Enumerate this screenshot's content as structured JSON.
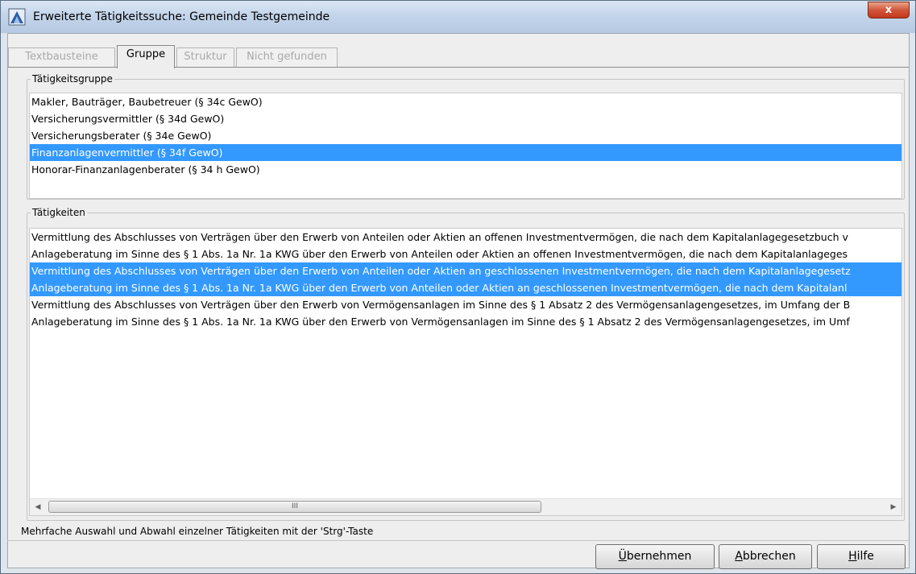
{
  "window": {
    "title": "Erweiterte Tätigkeitssuche: Gemeinde Testgemeinde",
    "close_glyph": "x"
  },
  "tabs": [
    {
      "label": "Textbausteine",
      "active": false
    },
    {
      "label": "Gruppe",
      "active": true
    },
    {
      "label": "Struktur",
      "active": false
    },
    {
      "label": "Nicht gefunden",
      "active": false
    }
  ],
  "group_section": {
    "legend": "Tätigkeitsgruppe",
    "items": [
      {
        "label": "Makler, Bauträger, Baubetreuer (§ 34c GewO)",
        "selected": false
      },
      {
        "label": "Versicherungsvermittler (§ 34d GewO)",
        "selected": false
      },
      {
        "label": "Versicherungsberater (§ 34e GewO)",
        "selected": false
      },
      {
        "label": "Finanzanlagenvermittler (§ 34f GewO)",
        "selected": true
      },
      {
        "label": "Honorar-Finanzanlagenberater (§ 34 h GewO)",
        "selected": false
      }
    ]
  },
  "activities_section": {
    "legend": "Tätigkeiten",
    "items": [
      {
        "label": "Vermittlung des Abschlusses von Verträgen über den Erwerb von Anteilen oder Aktien an offenen Investmentvermögen, die nach dem Kapitalanlagegesetzbuch v",
        "selected": false
      },
      {
        "label": "Anlageberatung im Sinne des § 1 Abs. 1a Nr. 1a KWG über den Erwerb von Anteilen oder Aktien an offenen Investmentvermögen, die nach dem Kapitalanlageges",
        "selected": false
      },
      {
        "label": "Vermittlung des Abschlusses von Verträgen über den Erwerb von Anteilen oder Aktien an geschlossenen Investmentvermögen, die nach dem Kapitalanlagegesetz",
        "selected": true
      },
      {
        "label": "Anlageberatung im Sinne des § 1 Abs. 1a Nr. 1a KWG über den Erwerb von Anteilen oder Aktien an geschlossenen Investmentvermögen, die nach dem Kapitalanl",
        "selected": true
      },
      {
        "label": "Vermittlung des Abschlusses von Verträgen über den Erwerb von Vermögensanlagen im Sinne des § 1 Absatz 2 des Vermögensanlagengesetzes, im Umfang der B",
        "selected": false
      },
      {
        "label": "Anlageberatung im Sinne des § 1 Abs. 1a Nr. 1a KWG über den Erwerb von Vermögensanlagen im Sinne des § 1 Absatz 2 des Vermögensanlagengesetzes, im Umf",
        "selected": false
      }
    ],
    "scrollbar": {
      "left_arrow": "◀",
      "right_arrow": "▶",
      "grip": "III"
    }
  },
  "hint": "Mehrfache Auswahl und Abwahl einzelner Tätigkeiten mit der 'Strg'-Taste",
  "buttons": {
    "apply": {
      "mnemonic": "Ü",
      "rest": "bernehmen"
    },
    "cancel": {
      "mnemonic": "A",
      "rest": "bbrechen"
    },
    "help": {
      "mnemonic": "H",
      "rest": "ilfe"
    }
  },
  "colors": {
    "selection": "#3399ff",
    "close_button": "#c2381c"
  }
}
